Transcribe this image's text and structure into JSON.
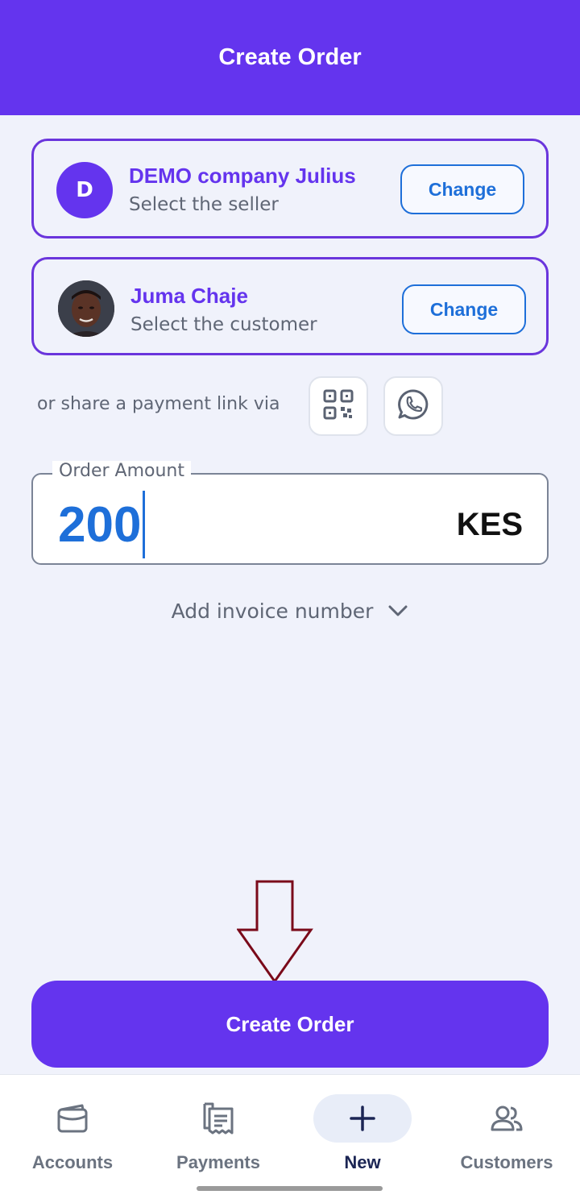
{
  "header": {
    "title": "Create Order"
  },
  "seller": {
    "avatar_letter": "D",
    "name": "DEMO company Julius",
    "subtitle": "Select the seller",
    "change_label": "Change"
  },
  "customer": {
    "name": "Juma Chaje",
    "subtitle": "Select the customer",
    "change_label": "Change"
  },
  "share": {
    "text": "or share a payment link via",
    "qr_icon": "qr-code-icon",
    "whatsapp_icon": "whatsapp-icon"
  },
  "amount": {
    "label": "Order Amount",
    "value": "200",
    "currency": "KES"
  },
  "invoice": {
    "label": "Add invoice number"
  },
  "create_button": {
    "label": "Create Order"
  },
  "nav": {
    "accounts": "Accounts",
    "payments": "Payments",
    "new": "New",
    "customers": "Customers"
  },
  "colors": {
    "brand": "#6434ee",
    "accent_blue": "#1e6fd9",
    "background": "#f0f2fb",
    "annotation_arrow": "#7a0a1a"
  }
}
